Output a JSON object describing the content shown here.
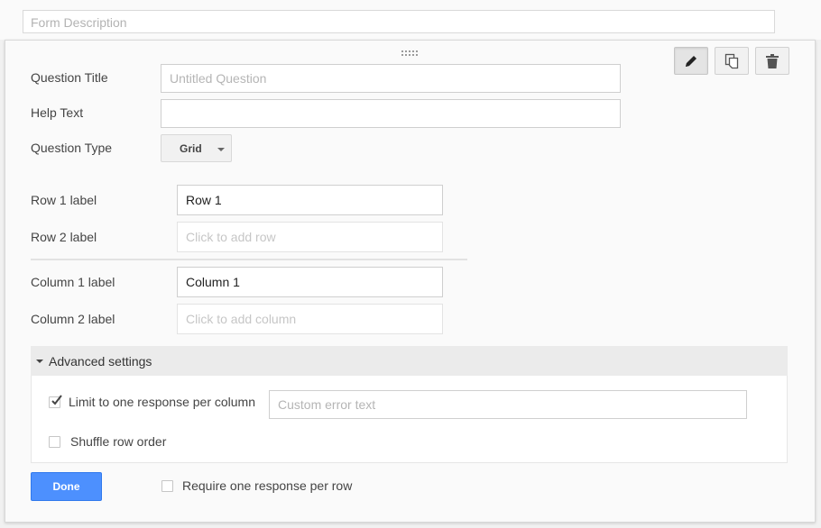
{
  "form_description": {
    "placeholder": "Form Description"
  },
  "toolbar": {
    "edit_icon": "pencil-icon",
    "duplicate_icon": "duplicate-icon",
    "delete_icon": "trash-icon"
  },
  "question": {
    "title_label": "Question Title",
    "title_placeholder": "Untitled Question",
    "help_label": "Help Text",
    "help_value": "",
    "type_label": "Question Type",
    "type_value": "Grid"
  },
  "rows": [
    {
      "label": "Row 1 label",
      "value": "Row 1"
    },
    {
      "label": "Row 2 label",
      "placeholder": "Click to add row"
    }
  ],
  "columns": [
    {
      "label": "Column 1 label",
      "value": "Column 1"
    },
    {
      "label": "Column 2 label",
      "placeholder": "Click to add column"
    }
  ],
  "advanced": {
    "header": "Advanced settings",
    "limit_label": "Limit to one response per column",
    "limit_checked": true,
    "custom_error_placeholder": "Custom error text",
    "shuffle_label": "Shuffle row order",
    "shuffle_checked": false
  },
  "footer": {
    "done_label": "Done",
    "require_label": "Require one response per row",
    "require_checked": false
  },
  "colors": {
    "accent": "#4d90fe",
    "background": "#f1f1f1"
  }
}
